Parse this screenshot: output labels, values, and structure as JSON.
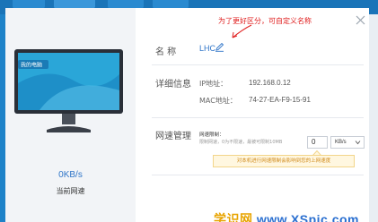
{
  "annotation": "为了更好区分，可自定义名称",
  "device": {
    "monitor_label": "我的电脑",
    "speed_value": "0KB/s",
    "speed_label": "当前网速"
  },
  "name_section": {
    "label": "名   称",
    "value": "LHC"
  },
  "details": {
    "label": "详细信息",
    "ip_label": "IP地址：",
    "ip_value": "192.168.0.12",
    "mac_label": "MAC地址：",
    "mac_value": "74-27-EA-F9-15-91"
  },
  "speed_mgmt": {
    "label": "网速管理",
    "limit_title": "网速限制：",
    "limit_desc": "限制网速，0为不限速，最被可限制10MB",
    "limit_value": "0",
    "unit": "KB/s",
    "tooltip": "对本机进行网速限制会影响到您的上网速度"
  },
  "watermark": {
    "text_cn": "学识网",
    "text_url": "www.XSpic.com"
  },
  "colors": {
    "accent": "#2f75c8",
    "annotation": "#e02020",
    "tooltip_bg": "#fff7e0",
    "tooltip_text": "#d08a1a"
  }
}
